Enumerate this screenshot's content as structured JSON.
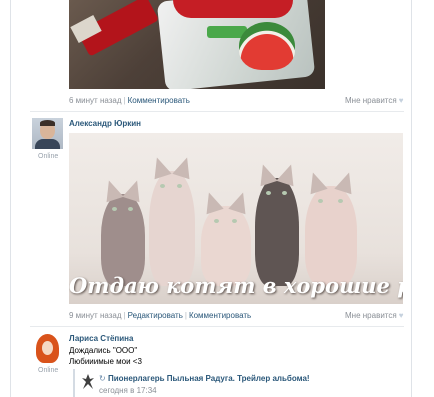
{
  "post1": {
    "time": "6 минут назад",
    "comment_link": "Комментировать",
    "like_label": "Мне нравится"
  },
  "post2": {
    "author": "Александр Юркин",
    "status": "Online",
    "photo_caption": "Отдаю котят в хорошие руки",
    "time": "9 минут назад",
    "edit_link": "Редактировать",
    "comment_link": "Комментировать",
    "like_label": "Мне нравится"
  },
  "post3": {
    "author": "Лариса Стёпина",
    "status": "Online",
    "text_line1": "Дождались \"ООО\"",
    "text_line2": "Любииимые мои <3",
    "repost": {
      "title": "Пионерлагерь Пыльная Радуга. Трейлер альбома!",
      "time": "сегодня в 17:34"
    }
  },
  "colors": {
    "link": "#2b587a",
    "muted": "#8a8f96",
    "divider": "#e7eaed"
  },
  "icons": {
    "like": "heart-icon",
    "share": "share-arrow-icon"
  }
}
